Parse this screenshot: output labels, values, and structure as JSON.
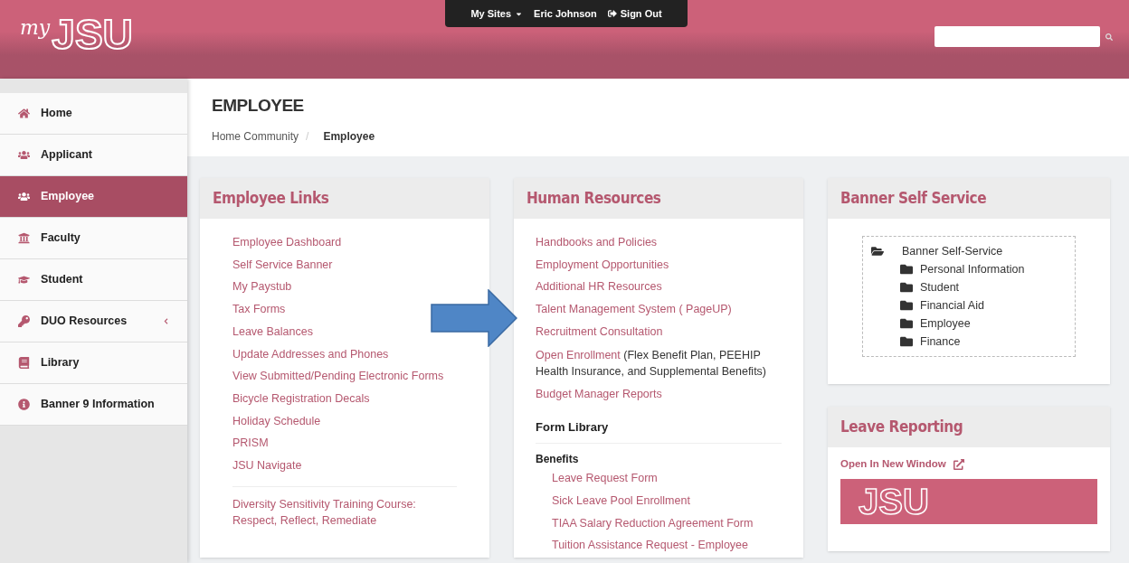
{
  "header": {
    "logo": {
      "script": "my",
      "letters": "JSU"
    },
    "user_menu": {
      "sites": "My Sites",
      "user": "Eric Johnson",
      "sign_out": "Sign Out"
    }
  },
  "sidebar": {
    "items": [
      {
        "label": "Home",
        "selected": false,
        "expandable": false
      },
      {
        "label": "Applicant",
        "selected": false,
        "expandable": false
      },
      {
        "label": "Employee",
        "selected": true,
        "expandable": false
      },
      {
        "label": "Faculty",
        "selected": false,
        "expandable": false
      },
      {
        "label": "Student",
        "selected": false,
        "expandable": false
      },
      {
        "label": "DUO Resources",
        "selected": false,
        "expandable": true
      },
      {
        "label": "Library",
        "selected": false,
        "expandable": false
      },
      {
        "label": "Banner 9 Information",
        "selected": false,
        "expandable": false
      }
    ]
  },
  "page": {
    "title": "EMPLOYEE",
    "breadcrumb": [
      "Home Community",
      "Employee"
    ],
    "breadcrumb_separator": "/"
  },
  "employee_links": {
    "title": "Employee Links",
    "links": [
      "Employee Dashboard",
      "Self Service Banner",
      "My Paystub",
      "Tax Forms",
      "Leave Balances",
      "Update Addresses and Phones",
      "View Submitted/Pending Electronic Forms",
      "Bicycle Registration Decals",
      "Holiday Schedule",
      "PRISM",
      "JSU Navigate"
    ],
    "extra_links": [
      "Diversity Sensitivity Training Course: Respect, Reflect, Remediate"
    ]
  },
  "human_resources": {
    "title": "Human Resources",
    "links": [
      {
        "kind": "link",
        "label": "Handbooks and Policies"
      },
      {
        "kind": "link",
        "label": "Employment Opportunities"
      },
      {
        "kind": "link",
        "label": "Additional HR Resources"
      },
      {
        "kind": "link",
        "label": "Talent Management System ( PageUP)"
      },
      {
        "kind": "link",
        "label": "Recruitment Consultation"
      },
      {
        "kind": "link_note",
        "label": "Open Enrollment",
        "note": "(Flex Benefit Plan, PEEHIP Health Insurance, and Supplemental Benefits)"
      },
      {
        "kind": "link",
        "label": "Budget Manager Reports"
      }
    ],
    "form_library": {
      "title": "Form Library",
      "section": "Benefits",
      "links": [
        "Leave Request Form",
        "Sick Leave Pool Enrollment",
        "TIAA Salary Reduction Agreement Form",
        "Tuition Assistance Request - Employee"
      ]
    }
  },
  "banner_self_service": {
    "title": "Banner Self Service",
    "tree": {
      "label": "Banner Self-Service",
      "expanded": true,
      "children": [
        {
          "label": "Personal Information",
          "expanded": false
        },
        {
          "label": "Student",
          "expanded": false
        },
        {
          "label": "Financial Aid",
          "expanded": false
        },
        {
          "label": "Employee",
          "expanded": false
        },
        {
          "label": "Finance",
          "expanded": false
        }
      ]
    }
  },
  "leave_reporting": {
    "title": "Leave Reporting",
    "open_link": "Open In New Window",
    "banner_logo": "JSU"
  }
}
